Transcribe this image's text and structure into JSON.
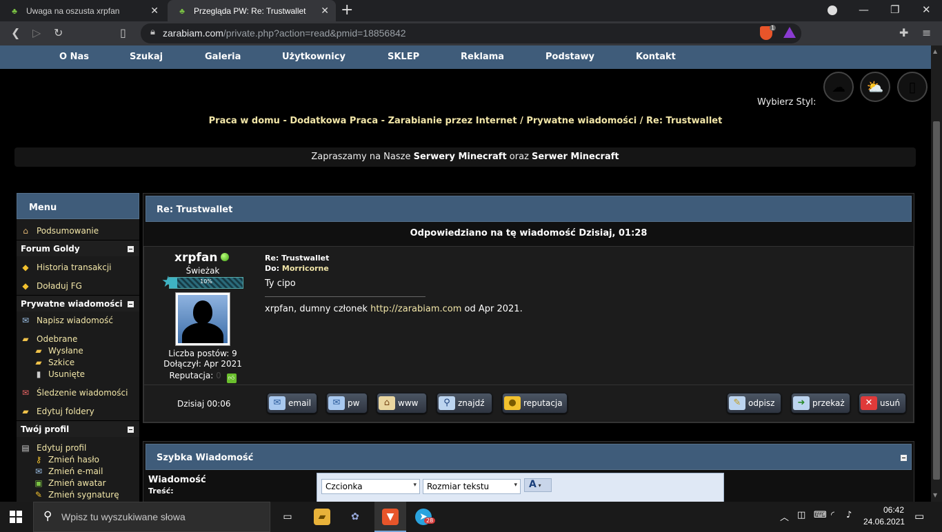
{
  "browser": {
    "tabs": [
      {
        "title": "Uwaga na oszusta xrpfan"
      },
      {
        "title": "Przegląda PW: Re: Trustwallet"
      }
    ],
    "url_host": "zarabiam.com",
    "url_path": "/private.php?action=read&pmid=18856842",
    "shield_count": "1"
  },
  "site": {
    "nav": [
      "O Nas",
      "Szukaj",
      "Galeria",
      "Użytkownicy",
      "SKLEP",
      "Reklama",
      "Podstawy",
      "Kontakt"
    ],
    "style_label": "Wybierz Styl:",
    "breadcrumb": "Praca w domu - Dodatkowa Praca - Zarabianie przez Internet / Prywatne wiadomości / Re: Trustwallet",
    "promo": {
      "prefix": "Zapraszamy na Nasze ",
      "link1": "Serwery Minecraft",
      "middle": " oraz ",
      "link2": "Serwer Minecraft"
    }
  },
  "sidebar": {
    "title": "Menu",
    "summary": "Podsumowanie",
    "cat_gold": "Forum Goldy",
    "gold_history": "Historia transakcji",
    "gold_topup": "Doładuj FG",
    "cat_pm": "Prywatne wiadomości",
    "pm_write": "Napisz wiadomość",
    "pm_inbox": "Odebrane",
    "pm_sent": "Wysłane",
    "pm_drafts": "Szkice",
    "pm_deleted": "Usunięte",
    "pm_tracking": "Śledzenie wiadomości",
    "pm_folders": "Edytuj foldery",
    "cat_profile": "Twój profil",
    "profile_edit": "Edytuj profil",
    "profile_password": "Zmień hasło",
    "profile_email": "Zmień e-mail",
    "profile_avatar": "Zmień awatar",
    "profile_signature": "Zmień sygnaturę"
  },
  "message": {
    "header": "Re: Trustwallet",
    "answered": "Odpowiedziano na tę wiadomość Dzisiaj, 01:28",
    "author": {
      "name": "xrpfan",
      "rank": "Świeżak",
      "rank_progress_text": "10%",
      "rank_progress": 0.1,
      "posts": "Liczba postów: 9",
      "joined": "Dołączył: Apr 2021",
      "reputation_label": "Reputacja:",
      "reputation_value": "0"
    },
    "subject": "Re: Trustwallet",
    "to_label": "Do: ",
    "to_user": "Morricorne",
    "body": "Ty cipo",
    "signature_prefix": "xrpfan, dumny członek ",
    "signature_link": "http://zarabiam.com",
    "signature_suffix": " od Apr 2021.",
    "time": "Dzisiaj 00:06",
    "buttons": {
      "email": "email",
      "pm": "pw",
      "www": "www",
      "find": "znajdź",
      "reputation": "reputacja",
      "reply": "odpisz",
      "forward": "przekaż",
      "delete": "usuń"
    }
  },
  "quick_reply": {
    "title": "Szybka Wiadomość",
    "label": "Wiadomość",
    "sublabel": "Treść:",
    "font_select": "Czcionka",
    "size_select": "Rozmiar tekstu"
  },
  "taskbar": {
    "search_placeholder": "Wpisz tu wyszukiwane słowa",
    "telegram_badge": "28",
    "time": "06:42",
    "date": "24.06.2021"
  }
}
